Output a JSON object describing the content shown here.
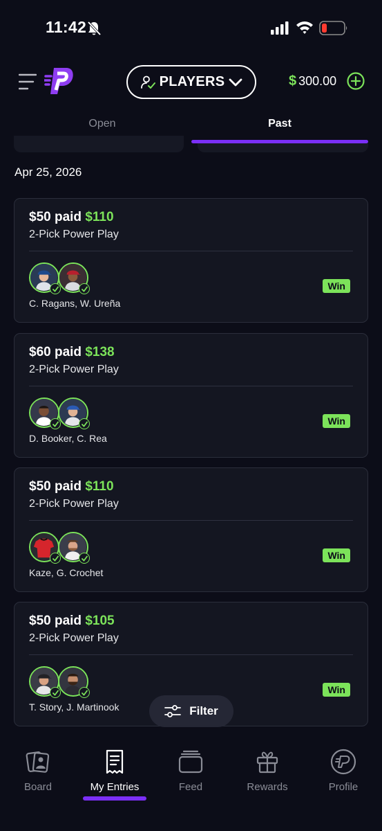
{
  "status_bar": {
    "time": "11:42"
  },
  "header": {
    "players_label": "PLAYERS",
    "balance_currency": "$",
    "balance_amount": "300.00"
  },
  "tabs": {
    "open": "Open",
    "past": "Past"
  },
  "date_header": "Apr 25, 2026",
  "entries": [
    {
      "paid": "$50 paid",
      "payout": "$110",
      "play_type": "2-Pick Power Play",
      "players": "C. Ragans, W. Ureña",
      "result": "Win"
    },
    {
      "paid": "$60 paid",
      "payout": "$138",
      "play_type": "2-Pick Power Play",
      "players": "D. Booker, C. Rea",
      "result": "Win"
    },
    {
      "paid": "$50 paid",
      "payout": "$110",
      "play_type": "2-Pick Power Play",
      "players": "Kaze, G. Crochet",
      "result": "Win"
    },
    {
      "paid": "$50 paid",
      "payout": "$105",
      "play_type": "2-Pick Power Play",
      "players": "T. Story, J. Martinook",
      "result": "Win"
    }
  ],
  "filter_label": "Filter",
  "nav": {
    "board": "Board",
    "my_entries": "My Entries",
    "feed": "Feed",
    "rewards": "Rewards",
    "profile": "Profile"
  },
  "colors": {
    "background": "#0c0d18",
    "card": "#141621",
    "accent_green": "#7ce35a",
    "accent_purple": "#7b2ff7"
  }
}
